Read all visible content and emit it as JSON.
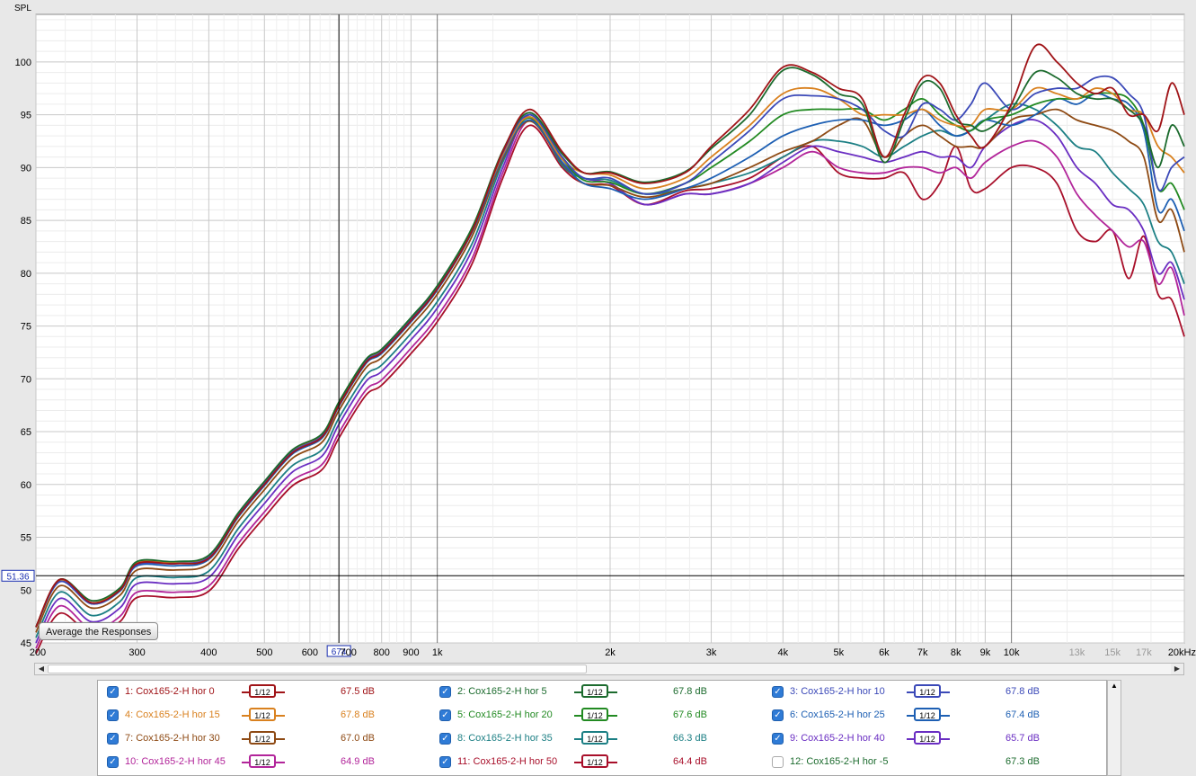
{
  "chart_data": {
    "type": "line",
    "ylabel": "SPL",
    "xlabel": "",
    "xscale": "log",
    "xlim": [
      200,
      20000
    ],
    "ylim": [
      45,
      104.5
    ],
    "grid": true,
    "yticks": [
      45,
      50,
      55,
      60,
      65,
      70,
      75,
      80,
      85,
      90,
      95,
      100
    ],
    "xtick_labels": [
      {
        "f": 200,
        "t": "200",
        "dim": false
      },
      {
        "f": 300,
        "t": "300",
        "dim": false
      },
      {
        "f": 400,
        "t": "400",
        "dim": false
      },
      {
        "f": 500,
        "t": "500",
        "dim": false
      },
      {
        "f": 600,
        "t": "600",
        "dim": false
      },
      {
        "f": 700,
        "t": "700",
        "dim": false
      },
      {
        "f": 800,
        "t": "800",
        "dim": false
      },
      {
        "f": 900,
        "t": "900",
        "dim": false
      },
      {
        "f": 1000,
        "t": "1k",
        "dim": false
      },
      {
        "f": 2000,
        "t": "2k",
        "dim": false
      },
      {
        "f": 3000,
        "t": "3k",
        "dim": false
      },
      {
        "f": 4000,
        "t": "4k",
        "dim": false
      },
      {
        "f": 5000,
        "t": "5k",
        "dim": false
      },
      {
        "f": 6000,
        "t": "6k",
        "dim": false
      },
      {
        "f": 7000,
        "t": "7k",
        "dim": false
      },
      {
        "f": 8000,
        "t": "8k",
        "dim": false
      },
      {
        "f": 9000,
        "t": "9k",
        "dim": false
      },
      {
        "f": 10000,
        "t": "10k",
        "dim": false
      },
      {
        "f": 13000,
        "t": "13k",
        "dim": true
      },
      {
        "f": 15000,
        "t": "15k",
        "dim": true
      },
      {
        "f": 17000,
        "t": "17k",
        "dim": true
      },
      {
        "f": 20000,
        "t": "20kHz",
        "dim": false
      }
    ],
    "cursor": {
      "freq": 674,
      "freq_label": "674",
      "spl": 51.36,
      "spl_label": "51.36"
    },
    "x": [
      200,
      220,
      250,
      280,
      300,
      350,
      400,
      450,
      500,
      560,
      630,
      674,
      750,
      800,
      900,
      1000,
      1150,
      1300,
      1450,
      1650,
      1800,
      2000,
      2300,
      2700,
      3000,
      3500,
      4000,
      4500,
      5000,
      5500,
      6000,
      6500,
      7000,
      7500,
      8000,
      8500,
      9000,
      10000,
      11000,
      12000,
      13000,
      14000,
      15000,
      16000,
      17000,
      18000,
      19000,
      20000
    ],
    "series": [
      {
        "name": "1: Cox165-2-H hor 0",
        "color": "#a01418",
        "values": [
          46.5,
          51.0,
          48.8,
          50.0,
          52.5,
          52.5,
          53.0,
          57.0,
          60.0,
          63.0,
          64.5,
          67.5,
          71.5,
          72.5,
          75.5,
          78.5,
          84.0,
          91.5,
          95.5,
          91.5,
          89.5,
          89.5,
          88.5,
          89.5,
          92.0,
          95.5,
          99.5,
          99.0,
          97.5,
          96.5,
          91.0,
          95.0,
          98.5,
          98.0,
          95.0,
          93.0,
          92.0,
          96.0,
          101.5,
          100.0,
          98.0,
          97.0,
          97.5,
          95.0,
          95.0,
          93.5,
          98.0,
          95.0
        ]
      },
      {
        "name": "2: Cox165-2-H hor 5",
        "color": "#1c6b2e",
        "values": [
          46.5,
          51.0,
          49.0,
          50.2,
          52.7,
          52.7,
          53.3,
          57.3,
          60.3,
          63.3,
          64.8,
          67.8,
          71.8,
          72.8,
          75.8,
          78.8,
          84.3,
          91.6,
          95.2,
          91.3,
          89.5,
          89.6,
          88.6,
          89.6,
          91.8,
          95.0,
          99.2,
          98.8,
          97.0,
          96.0,
          90.5,
          94.5,
          98.0,
          97.5,
          94.5,
          94.0,
          93.5,
          95.5,
          99.0,
          98.5,
          97.0,
          96.5,
          96.5,
          95.5,
          94.0,
          90.0,
          94.0,
          92.0
        ]
      },
      {
        "name": "3: Cox165-2-H hor 10",
        "color": "#3b49b8",
        "values": [
          46.5,
          50.8,
          48.7,
          50.0,
          52.4,
          52.5,
          53.1,
          57.1,
          60.1,
          63.1,
          64.6,
          67.6,
          71.6,
          72.6,
          75.6,
          78.6,
          84.1,
          91.4,
          95.0,
          91.0,
          89.0,
          89.0,
          87.5,
          88.5,
          90.5,
          93.5,
          96.5,
          96.8,
          96.5,
          95.5,
          93.5,
          93.0,
          96.0,
          95.5,
          94.5,
          96.0,
          98.0,
          95.5,
          97.0,
          97.5,
          97.5,
          98.5,
          98.5,
          97.0,
          95.0,
          88.0,
          90.0,
          91.0
        ]
      },
      {
        "name": "4: Cox165-2-H hor 15",
        "color": "#d9811f",
        "values": [
          46.5,
          50.9,
          48.8,
          50.1,
          52.6,
          52.6,
          53.2,
          57.2,
          60.2,
          63.2,
          64.7,
          67.7,
          71.7,
          72.7,
          75.7,
          78.7,
          84.2,
          91.2,
          94.8,
          90.8,
          89.5,
          89.3,
          88.0,
          89.0,
          91.0,
          94.0,
          97.0,
          97.5,
          96.5,
          95.0,
          95.0,
          95.0,
          95.5,
          94.5,
          94.0,
          94.0,
          95.5,
          95.5,
          97.5,
          97.0,
          96.5,
          97.5,
          97.0,
          95.5,
          95.0,
          92.0,
          91.0,
          89.5
        ]
      },
      {
        "name": "5: Cox165-2-H hor 20",
        "color": "#228a22",
        "values": [
          46.5,
          50.9,
          48.8,
          50.1,
          52.6,
          52.6,
          53.2,
          57.2,
          60.2,
          63.2,
          64.7,
          67.8,
          71.8,
          72.8,
          75.8,
          78.8,
          84.3,
          91.3,
          94.7,
          90.8,
          88.8,
          88.6,
          87.5,
          88.5,
          90.0,
          92.5,
          95.0,
          95.5,
          95.5,
          95.5,
          94.5,
          95.5,
          96.5,
          95.0,
          94.0,
          93.5,
          94.5,
          95.0,
          96.0,
          96.5,
          96.5,
          97.0,
          97.0,
          96.5,
          94.0,
          88.0,
          88.5,
          86.0
        ]
      },
      {
        "name": "6: Cox165-2-H hor 25",
        "color": "#1d5fb3",
        "values": [
          46.5,
          50.8,
          48.7,
          49.9,
          52.3,
          52.3,
          52.9,
          56.9,
          59.9,
          62.9,
          64.4,
          67.4,
          71.4,
          72.4,
          75.4,
          78.4,
          83.9,
          91.0,
          94.5,
          90.5,
          88.5,
          88.0,
          87.0,
          88.0,
          89.0,
          91.0,
          93.0,
          94.0,
          94.5,
          94.5,
          94.0,
          94.5,
          95.5,
          94.0,
          93.0,
          93.5,
          94.5,
          94.0,
          95.0,
          96.5,
          96.0,
          97.0,
          96.5,
          96.0,
          93.5,
          86.0,
          87.0,
          84.0
        ]
      },
      {
        "name": "7: Cox165-2-H hor 30",
        "color": "#8e4a14",
        "values": [
          46.0,
          50.4,
          48.3,
          49.5,
          51.9,
          51.9,
          52.5,
          56.5,
          59.5,
          62.5,
          64.0,
          67.0,
          71.0,
          72.0,
          75.0,
          78.0,
          83.5,
          90.8,
          94.4,
          90.4,
          88.5,
          88.3,
          87.2,
          88.0,
          88.5,
          90.0,
          91.5,
          92.5,
          94.0,
          94.5,
          91.0,
          93.0,
          94.0,
          93.0,
          92.0,
          92.0,
          92.0,
          94.5,
          95.0,
          95.5,
          94.5,
          94.0,
          93.5,
          92.5,
          91.0,
          85.0,
          86.0,
          82.0
        ]
      },
      {
        "name": "8: Cox165-2-H hor 35",
        "color": "#1c7f84",
        "values": [
          45.5,
          49.8,
          47.6,
          48.9,
          51.2,
          51.2,
          51.8,
          55.8,
          58.8,
          61.8,
          63.3,
          66.3,
          70.3,
          71.3,
          74.3,
          77.3,
          82.8,
          90.5,
          94.8,
          90.2,
          89.0,
          88.8,
          87.5,
          88.0,
          88.5,
          89.5,
          91.0,
          92.5,
          92.5,
          92.0,
          91.0,
          92.0,
          93.0,
          93.5,
          93.0,
          93.5,
          94.5,
          96.0,
          95.5,
          94.0,
          92.0,
          91.5,
          89.5,
          88.0,
          86.5,
          83.0,
          82.0,
          79.0
        ]
      },
      {
        "name": "9: Cox165-2-H hor 40",
        "color": "#6a2ec2",
        "values": [
          45.0,
          49.2,
          47.0,
          48.3,
          50.6,
          50.6,
          51.2,
          55.2,
          58.2,
          61.2,
          62.7,
          65.7,
          69.7,
          70.7,
          73.7,
          76.7,
          82.2,
          90.0,
          95.0,
          90.5,
          89.0,
          88.5,
          86.5,
          87.5,
          87.5,
          88.5,
          90.5,
          92.0,
          91.5,
          91.0,
          90.5,
          91.0,
          91.5,
          91.0,
          91.0,
          90.0,
          92.0,
          94.0,
          94.5,
          93.0,
          90.0,
          88.5,
          86.5,
          86.0,
          84.0,
          80.0,
          81.0,
          77.5
        ]
      },
      {
        "name": "10: Cox165-2-H hor 45",
        "color": "#b2259a",
        "values": [
          44.5,
          48.5,
          46.3,
          47.5,
          49.8,
          49.8,
          50.4,
          54.4,
          57.4,
          60.4,
          61.9,
          64.9,
          68.9,
          69.9,
          72.9,
          75.9,
          81.4,
          89.5,
          94.5,
          90.5,
          89.0,
          88.5,
          86.5,
          87.5,
          87.5,
          88.5,
          90.0,
          91.5,
          90.0,
          89.5,
          89.5,
          90.0,
          90.0,
          89.5,
          90.0,
          89.0,
          90.5,
          92.0,
          92.5,
          91.0,
          87.5,
          85.5,
          84.0,
          82.5,
          83.0,
          79.0,
          80.5,
          76.0
        ]
      },
      {
        "name": "11: Cox165-2-H hor 50",
        "color": "#a80f2a",
        "values": [
          44.0,
          47.8,
          45.8,
          47.0,
          49.3,
          49.3,
          49.9,
          53.9,
          56.9,
          59.9,
          61.4,
          64.4,
          68.4,
          69.4,
          72.4,
          75.4,
          80.9,
          89.0,
          94.0,
          90.0,
          88.5,
          88.3,
          86.5,
          87.8,
          88.0,
          89.0,
          91.0,
          92.0,
          89.5,
          89.0,
          89.0,
          89.5,
          87.0,
          88.5,
          92.0,
          88.0,
          88.0,
          90.0,
          90.0,
          88.5,
          84.0,
          83.0,
          84.0,
          79.5,
          83.5,
          78.0,
          77.5,
          74.0
        ]
      }
    ]
  },
  "plot": {
    "ylabel": "SPL",
    "average_button_label": "Average the Responses"
  },
  "legend": {
    "items": [
      {
        "label": "1: Cox165-2-H hor 0",
        "smoothing": "1/12",
        "value": "67.5 dB",
        "checked": true,
        "color": "#a01418"
      },
      {
        "label": "2: Cox165-2-H hor 5",
        "smoothing": "1/12",
        "value": "67.8 dB",
        "checked": true,
        "color": "#1c6b2e"
      },
      {
        "label": "3: Cox165-2-H hor 10",
        "smoothing": "1/12",
        "value": "67.8 dB",
        "checked": true,
        "color": "#3b49b8"
      },
      {
        "label": "4: Cox165-2-H hor 15",
        "smoothing": "1/12",
        "value": "67.8 dB",
        "checked": true,
        "color": "#d9811f"
      },
      {
        "label": "5: Cox165-2-H hor 20",
        "smoothing": "1/12",
        "value": "67.6 dB",
        "checked": true,
        "color": "#228a22"
      },
      {
        "label": "6: Cox165-2-H hor 25",
        "smoothing": "1/12",
        "value": "67.4 dB",
        "checked": true,
        "color": "#1d5fb3"
      },
      {
        "label": "7: Cox165-2-H hor 30",
        "smoothing": "1/12",
        "value": "67.0 dB",
        "checked": true,
        "color": "#8e4a14"
      },
      {
        "label": "8: Cox165-2-H hor 35",
        "smoothing": "1/12",
        "value": "66.3 dB",
        "checked": true,
        "color": "#1c7f84"
      },
      {
        "label": "9: Cox165-2-H hor 40",
        "smoothing": "1/12",
        "value": "65.7 dB",
        "checked": true,
        "color": "#6a2ec2"
      },
      {
        "label": "10: Cox165-2-H hor 45",
        "smoothing": "1/12",
        "value": "64.9 dB",
        "checked": true,
        "color": "#b2259a"
      },
      {
        "label": "11: Cox165-2-H hor 50",
        "smoothing": "1/12",
        "value": "64.4 dB",
        "checked": true,
        "color": "#a80f2a"
      },
      {
        "label": "12: Cox165-2-H hor  -5",
        "smoothing": "",
        "value": "67.3 dB",
        "checked": false,
        "color": "#1c6b2e"
      }
    ]
  }
}
